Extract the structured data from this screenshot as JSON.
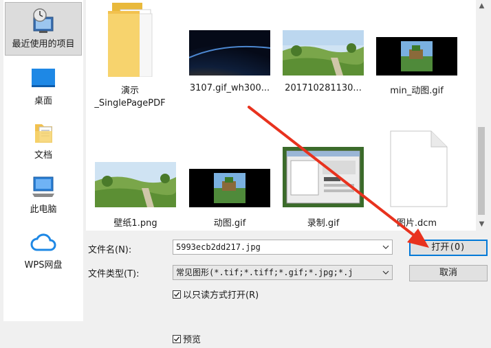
{
  "sidebar": {
    "items": [
      {
        "label": "最近使用的项目",
        "icon": "recent-clock-icon"
      },
      {
        "label": "桌面",
        "icon": "desktop-icon"
      },
      {
        "label": "文档",
        "icon": "documents-icon"
      },
      {
        "label": "此电脑",
        "icon": "computer-icon"
      },
      {
        "label": "WPS网盘",
        "icon": "cloud-icon"
      }
    ]
  },
  "files": [
    {
      "name_line1": "演示",
      "name_line2": "_SinglePagePDF",
      "icon": "folder-icon"
    },
    {
      "name_line1": "3107.gif_wh300...",
      "icon": "earth-night-thumbnail"
    },
    {
      "name_line1": "201710281130...",
      "icon": "landscape-thumbnail"
    },
    {
      "name_line1": "min_动图.gif",
      "icon": "minecraft-thumbnail"
    },
    {
      "name_line1": "壁纸1.png",
      "icon": "landscape-thumbnail"
    },
    {
      "name_line1": "动图.gif",
      "icon": "minecraft-thumbnail"
    },
    {
      "name_line1": "录制.gif",
      "icon": "screen-recording-thumbnail"
    },
    {
      "name_line1": "图片.dcm",
      "icon": "blank-document-icon"
    }
  ],
  "form": {
    "filename_label": "文件名(N):",
    "filename_value": "5993ecb2dd217.jpg",
    "filetype_label": "文件类型(T):",
    "filetype_value": "常见图形(*.tif;*.tiff;*.gif;*.jpg;*.j",
    "readonly_label": "以只读方式打开(R)",
    "readonly_checked": true,
    "preview_label": "预览",
    "preview_checked": true
  },
  "buttons": {
    "open": "打开(O)",
    "cancel": "取消"
  },
  "colors": {
    "accent": "#0078d7",
    "annotation_arrow": "#e8321e",
    "folder": "#f7d36d"
  }
}
